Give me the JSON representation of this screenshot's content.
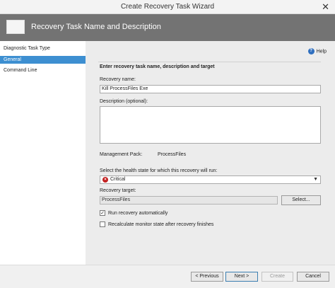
{
  "window": {
    "title": "Create Recovery Task Wizard",
    "close_glyph": "✕"
  },
  "banner": {
    "heading": "Recovery Task Name and Description"
  },
  "sidebar": {
    "items": [
      {
        "label": "Diagnostic Task Type"
      },
      {
        "label": "General"
      },
      {
        "label": "Command Line"
      }
    ]
  },
  "main": {
    "help_label": "Help",
    "section_title": "Enter recovery task name, description and target",
    "recovery_name_label": "Recovery name:",
    "recovery_name_value": "Kill ProcessFiles Exe",
    "description_label": "Description (optional):",
    "description_value": "",
    "management_pack_label": "Management Pack:",
    "management_pack_value": "ProcessFiles",
    "health_state_label": "Select the health state for which this recovery will run:",
    "health_state_value": "Critical",
    "recovery_target_label": "Recovery target:",
    "recovery_target_value": "ProcessFiles",
    "select_button": "Select...",
    "run_auto_label": "Run recovery automatically",
    "run_auto_checked": true,
    "recalc_label": "Recalculate monitor state after recovery finishes",
    "recalc_checked": false
  },
  "footer": {
    "previous": "< Previous",
    "next": "Next >",
    "create": "Create",
    "cancel": "Cancel"
  },
  "colors": {
    "banner": "#737373",
    "selected": "#3d8fd1",
    "critical": "#c21f1f"
  }
}
